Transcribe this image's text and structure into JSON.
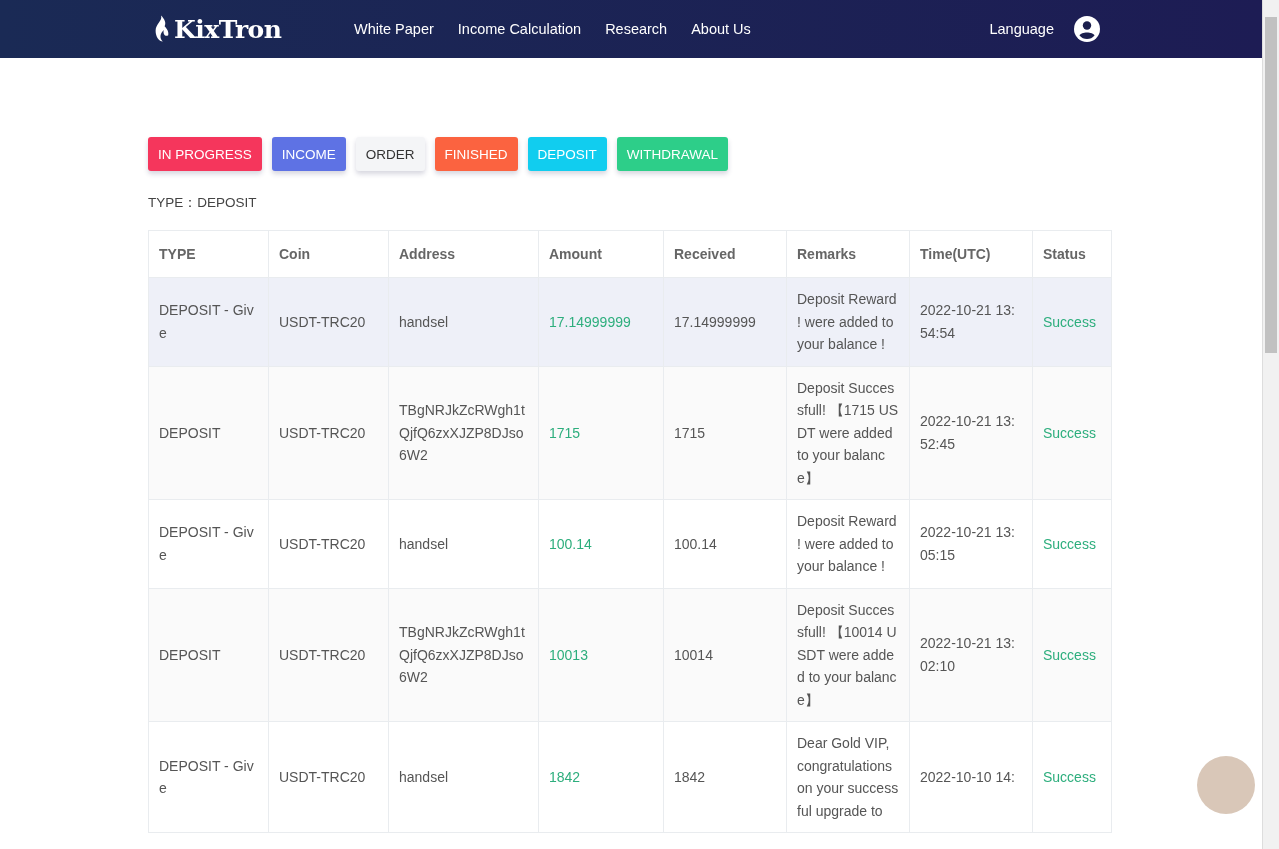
{
  "header": {
    "logo": "KixTron",
    "nav": [
      "White Paper",
      "Income Calculation",
      "Research",
      "About Us"
    ],
    "language": "Language"
  },
  "filters": [
    {
      "label": "IN PROGRESS",
      "color": "#f5365c"
    },
    {
      "label": "INCOME",
      "color": "#5e72e4"
    },
    {
      "label": "ORDER",
      "color": "#f4f5f7"
    },
    {
      "label": "FINISHED",
      "color": "#fb6340"
    },
    {
      "label": "DEPOSIT",
      "color": "#11cdef"
    },
    {
      "label": "WITHDRAWAL",
      "color": "#2dce89"
    }
  ],
  "type_label": "TYPE：DEPOSIT",
  "table": {
    "columns": [
      "TYPE",
      "Coin",
      "Address",
      "Amount",
      "Received",
      "Remarks",
      "Time(UTC)",
      "Status"
    ],
    "rows": [
      {
        "highlighted": true,
        "cells": [
          "DEPOSIT - Give",
          "USDT-TRC20",
          "handsel",
          "17.14999999",
          "17.14999999",
          "Deposit Reward ! were added to your balance !",
          "2022-10-21 13:54:54",
          "Success"
        ]
      },
      {
        "highlighted": false,
        "cells": [
          "DEPOSIT",
          "USDT-TRC20",
          "TBgNRJkZcRWgh1tQjfQ6zxXJZP8DJso6W2",
          "1715",
          "1715",
          "Deposit Successfull! 【1715 USDT were added to your balance】",
          "2022-10-21 13:52:45",
          "Success"
        ]
      },
      {
        "highlighted": false,
        "cells": [
          "DEPOSIT - Give",
          "USDT-TRC20",
          "handsel",
          "100.14",
          "100.14",
          "Deposit Reward ! were added to your balance !",
          "2022-10-21 13:05:15",
          "Success"
        ]
      },
      {
        "highlighted": false,
        "cells": [
          "DEPOSIT",
          "USDT-TRC20",
          "TBgNRJkZcRWgh1tQjfQ6zxXJZP8DJso6W2",
          "10013",
          "10014",
          "Deposit Successfull! 【10014 USDT were added to your balance】",
          "2022-10-21 13:02:10",
          "Success"
        ]
      },
      {
        "highlighted": false,
        "cells": [
          "DEPOSIT - Give",
          "USDT-TRC20",
          "handsel",
          "1842",
          "1842",
          "Dear Gold VIP, congratulations on your successful upgrade to",
          "2022-10-10 14:",
          "Success"
        ]
      }
    ]
  }
}
